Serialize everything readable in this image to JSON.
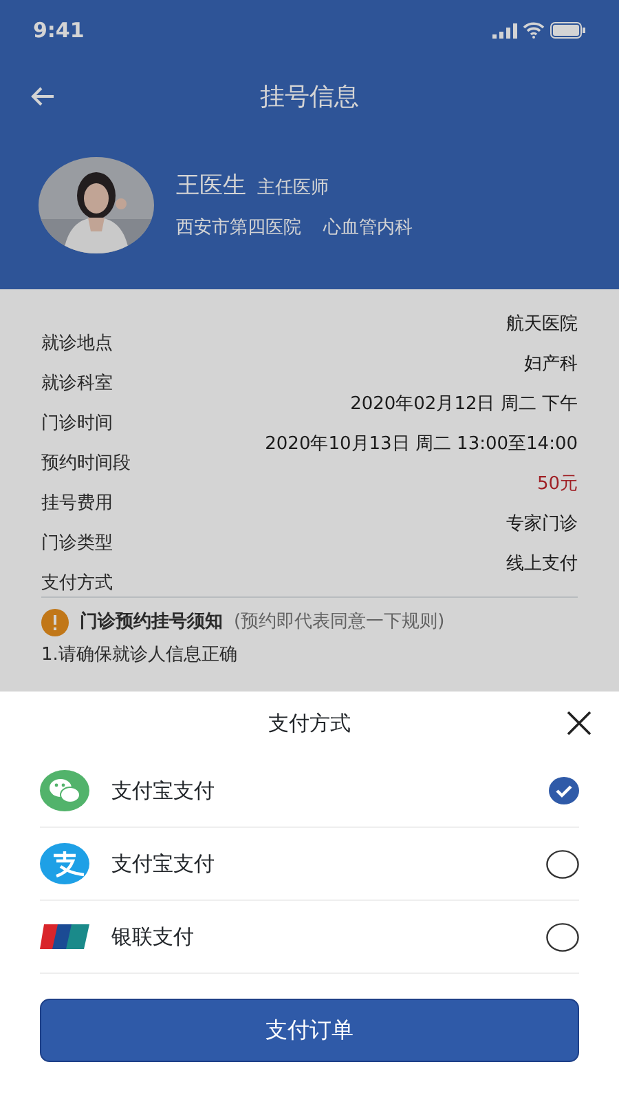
{
  "status_bar": {
    "time": "9:41"
  },
  "nav": {
    "title": "挂号信息"
  },
  "doctor": {
    "name": "王医生",
    "rank": "主任医师",
    "hospital": "西安市第四医院",
    "department": "心血管内科"
  },
  "details": [
    {
      "label": "就诊地点",
      "value": "航天医院",
      "kind": "plain"
    },
    {
      "label": "就诊科室",
      "value": "妇产科",
      "kind": "plain"
    },
    {
      "label": "门诊时间",
      "value": "2020年02月12日 周二 下午",
      "kind": "plain"
    },
    {
      "label": "预约时间段",
      "value": "2020年10月13日 周二 13:00至14:00",
      "kind": "plain"
    },
    {
      "label": "挂号费用",
      "value": "50元",
      "kind": "price"
    },
    {
      "label": "门诊类型",
      "value": "专家门诊",
      "kind": "plain"
    },
    {
      "label": "支付方式",
      "value": "线上支付",
      "kind": "plain"
    }
  ],
  "notice": {
    "title": "门诊预约挂号须知",
    "note": "(预约即代表同意一下规则)",
    "lines": [
      "1.请确保就诊人信息正确"
    ]
  },
  "sheet": {
    "title": "支付方式",
    "options": [
      {
        "kind": "wechat",
        "label": "支付宝支付",
        "selected": true
      },
      {
        "kind": "alipay",
        "label": "支付宝支付",
        "selected": false
      },
      {
        "kind": "unionpay",
        "label": "银联支付",
        "selected": false
      }
    ],
    "button": "支付订单"
  }
}
